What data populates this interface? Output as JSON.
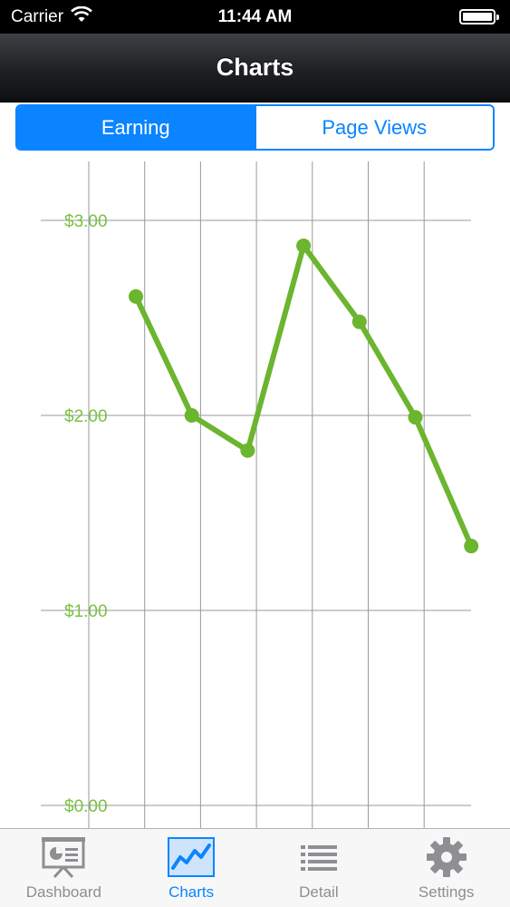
{
  "status_bar": {
    "carrier": "Carrier",
    "time": "11:44 AM"
  },
  "nav": {
    "title": "Charts"
  },
  "segmented": [
    {
      "label": "Earning",
      "selected": true
    },
    {
      "label": "Page Views",
      "selected": false
    }
  ],
  "chart_data": {
    "type": "line",
    "title": "",
    "y_ticks": [
      "$3.00",
      "$2.00",
      "$1.00",
      "$0.00"
    ],
    "ylim": [
      0,
      3
    ],
    "x": [
      1,
      2,
      3,
      4,
      5,
      6,
      7
    ],
    "series": [
      {
        "values": [
          2.61,
          2.0,
          1.82,
          2.87,
          2.48,
          1.99,
          1.33
        ],
        "color": "#6bb52f"
      }
    ],
    "grid": true,
    "background_label": "Earning"
  },
  "tabs": [
    {
      "label": "Dashboard",
      "icon": "presentation-icon",
      "active": false
    },
    {
      "label": "Charts",
      "icon": "line-chart-icon",
      "active": true
    },
    {
      "label": "Detail",
      "icon": "list-icon",
      "active": false
    },
    {
      "label": "Settings",
      "icon": "gear-icon",
      "active": false
    }
  ],
  "colors": {
    "accent": "#0a84ff",
    "chart_line": "#6bb52f",
    "axis_label": "#7ac143"
  }
}
